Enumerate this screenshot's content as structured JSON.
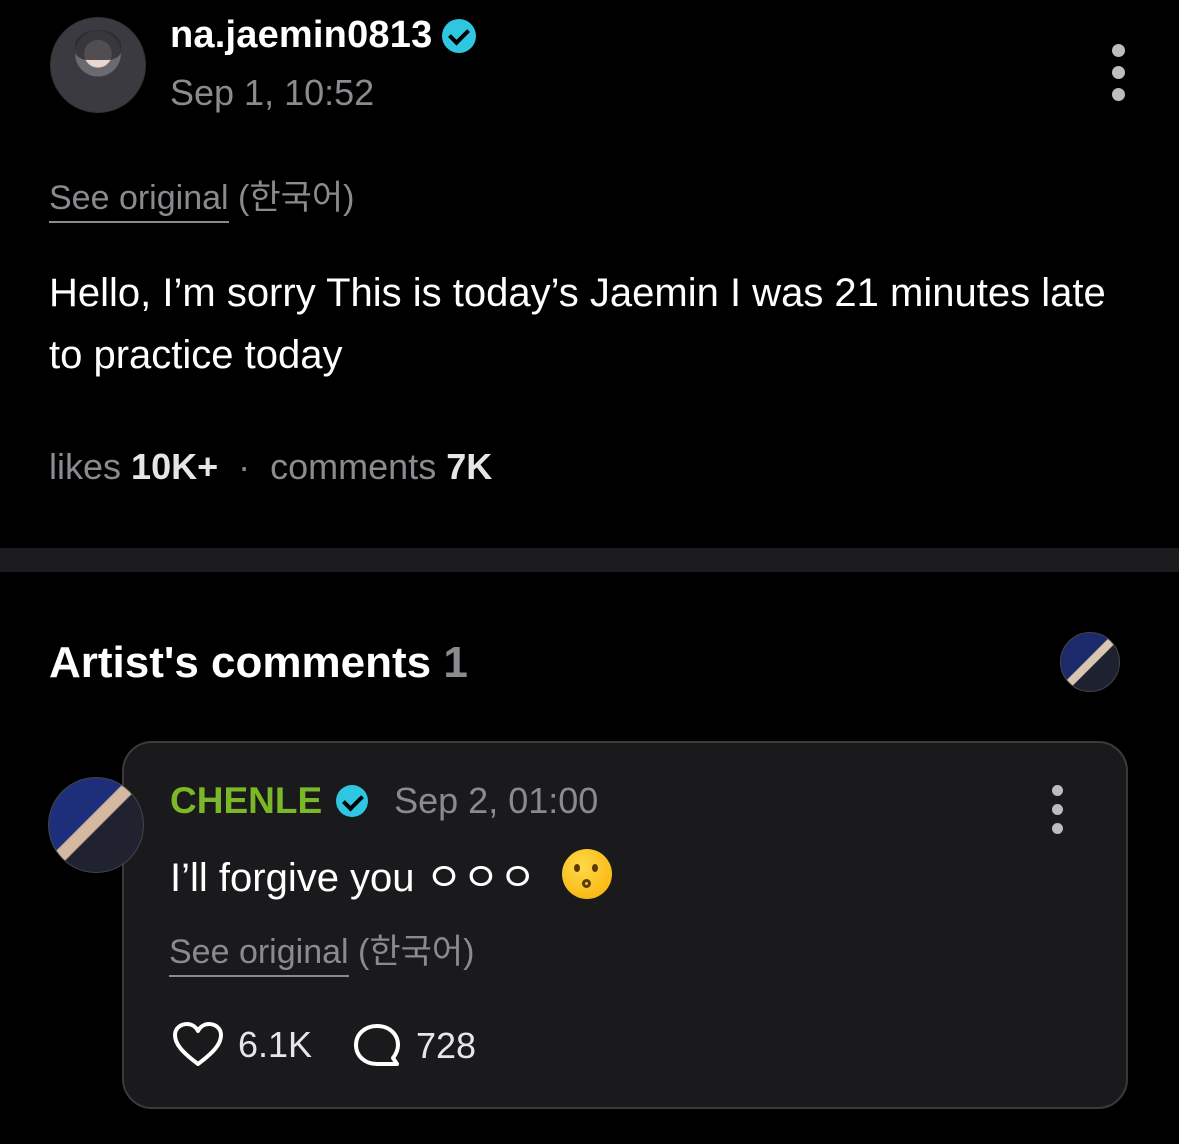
{
  "post": {
    "username": "na.jaemin0813",
    "timestamp": "Sep 1, 10:52",
    "see_original": "See original",
    "language": "(한국어)",
    "text": "Hello, I’m sorry This is today’s Jaemin I was 21 minutes late to practice today",
    "likes_label": "likes",
    "likes_count": "10K+",
    "separator": "·",
    "comments_label": "comments",
    "comments_count": "7K"
  },
  "artist_comments": {
    "title": "Artist's comments",
    "count": "1"
  },
  "comment": {
    "name": "CHENLE",
    "timestamp": "Sep 2, 01:00",
    "text": "I’ll forgive you ㅇㅇㅇ",
    "emoji": "kissing-face",
    "see_original": "See original",
    "language": "(한국어)",
    "likes": "6.1K",
    "replies": "728"
  },
  "colors": {
    "background": "#000000",
    "verified": "#2ec6e0",
    "artist_name": "#7ab828",
    "muted": "#8b8b8f",
    "card": "#1a1a1c"
  }
}
